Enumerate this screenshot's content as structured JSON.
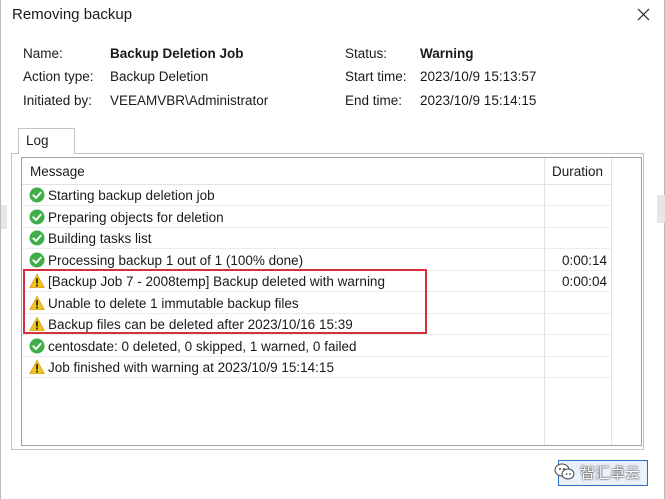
{
  "window": {
    "title": "Removing backup"
  },
  "summary": {
    "name_label": "Name:",
    "name_value": "Backup Deletion Job",
    "action_label": "Action type:",
    "action_value": "Backup Deletion",
    "initiated_label": "Initiated by:",
    "initiated_value": "VEEAMVBR\\Administrator",
    "status_label": "Status:",
    "status_value": "Warning",
    "start_label": "Start time:",
    "start_value": "2023/10/9 15:13:57",
    "end_label": "End time:",
    "end_value": "2023/10/9 15:14:15"
  },
  "tabs": [
    {
      "label": "Log"
    }
  ],
  "log": {
    "columns": {
      "message": "Message",
      "duration": "Duration"
    },
    "rows": [
      {
        "status": "success",
        "icon": "check-circle-icon",
        "message": "Starting backup deletion job",
        "duration": ""
      },
      {
        "status": "success",
        "icon": "check-circle-icon",
        "message": "Preparing objects for deletion",
        "duration": ""
      },
      {
        "status": "success",
        "icon": "check-circle-icon",
        "message": "Building tasks list",
        "duration": ""
      },
      {
        "status": "success",
        "icon": "check-circle-icon",
        "message": "Processing backup 1 out of 1 (100% done)",
        "duration": "0:00:14"
      },
      {
        "status": "warning",
        "icon": "warning-triangle-icon",
        "message": "[Backup Job 7 - 2008temp] Backup deleted with warning",
        "duration": "0:00:04"
      },
      {
        "status": "warning",
        "icon": "warning-triangle-icon",
        "message": "Unable to delete 1 immutable backup files",
        "duration": ""
      },
      {
        "status": "warning",
        "icon": "warning-triangle-icon",
        "message": "Backup files can be deleted after 2023/10/16 15:39",
        "duration": ""
      },
      {
        "status": "success",
        "icon": "check-circle-icon",
        "message": "centosdate: 0 deleted, 0 skipped, 1 warned, 0 failed",
        "duration": ""
      },
      {
        "status": "warning",
        "icon": "warning-triangle-icon",
        "message": "Job finished with warning at 2023/10/9 15:14:15",
        "duration": ""
      }
    ]
  },
  "watermark": {
    "text": "智汇卓云",
    "icon": "wechat-icon"
  },
  "colors": {
    "success": "#3fae49",
    "warning": "#f3c21b",
    "highlight": "#d8303a",
    "accent": "#2a6fc0"
  }
}
